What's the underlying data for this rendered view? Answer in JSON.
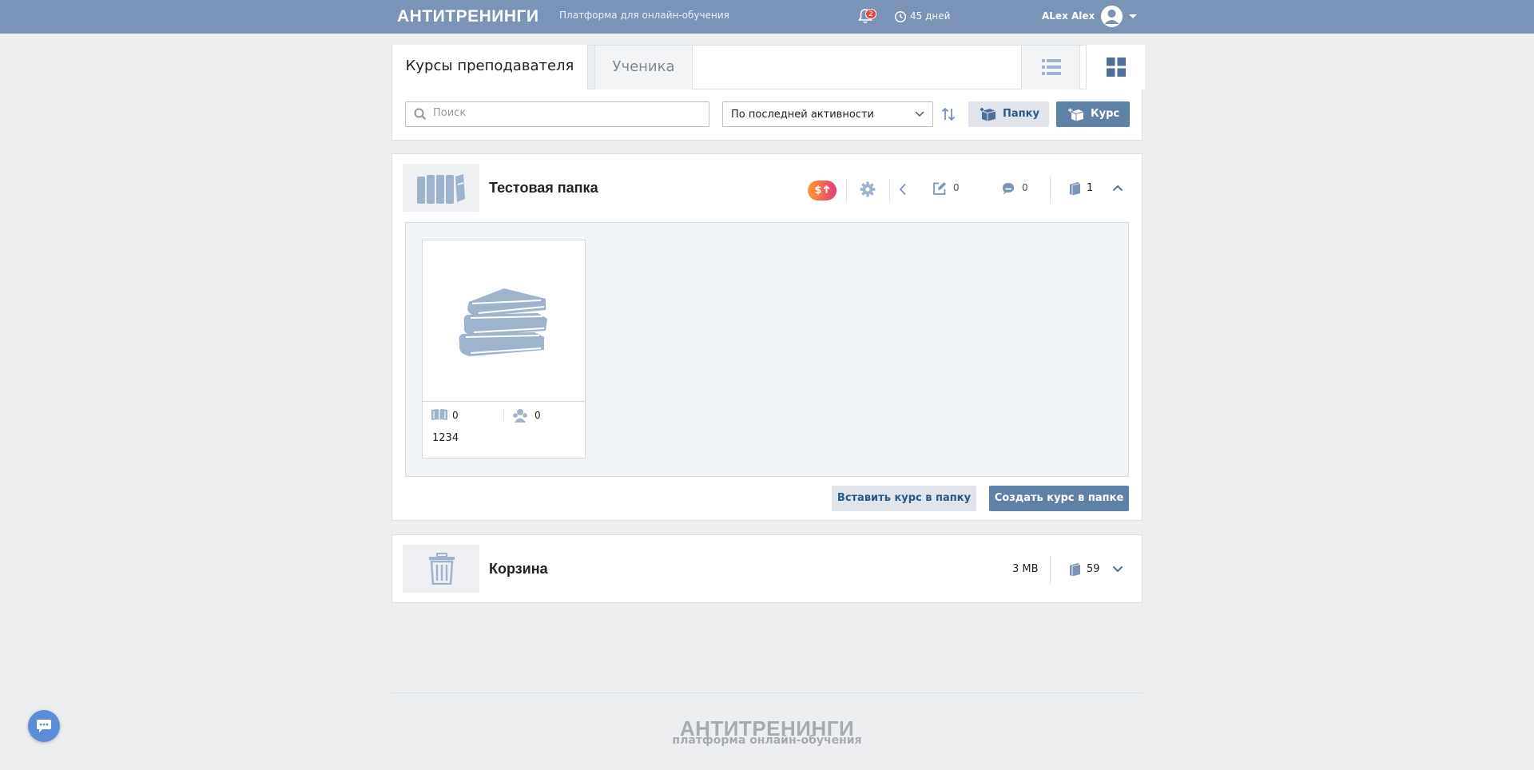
{
  "topbar": {
    "logo": "АНТИТРЕНИНГИ",
    "tagline": "Платформа для онлайн-обучения",
    "notifications_count": "2",
    "days_left": "45 дней",
    "user_name": "ALex Alex"
  },
  "tabs": {
    "teacher": "Курсы преподавателя",
    "student": "Ученика"
  },
  "toolbar": {
    "search_placeholder": "Поиск",
    "sort_value": "По последней активности",
    "folder_button": "Папку",
    "course_button": "Курс"
  },
  "folder": {
    "title": "Тестовая папка",
    "money_badge": "$",
    "edits_count": "0",
    "comments_count": "0",
    "courses_count": "1",
    "course": {
      "lessons": "0",
      "students": "0",
      "name": "1234"
    },
    "insert_button": "Вставить курс в папку",
    "create_button": "Создать курс в папке"
  },
  "trash": {
    "title": "Корзина",
    "size": "3 MB",
    "items_count": "59"
  },
  "footer": {
    "logo": "АНТИТРЕНИНГИ",
    "tagline": "платформа онлайн-обучения"
  },
  "colors": {
    "topbar": "#7b93b6",
    "accent_button": "#5e81a8",
    "icon": "#9fb3cc",
    "chat_fab": "#5b8ed6"
  },
  "icons": [
    "bell-icon",
    "clock-icon",
    "avatar-icon",
    "list-view-icon",
    "grid-view-icon",
    "search-icon",
    "sort-direction-icon",
    "folder-add-icon",
    "course-add-icon",
    "gear-icon",
    "back-arrow-icon",
    "edit-icon",
    "comments-icon",
    "document-icon",
    "chevron-up-icon",
    "chevron-down-icon",
    "trash-icon",
    "books-icon",
    "chat-icon"
  ]
}
